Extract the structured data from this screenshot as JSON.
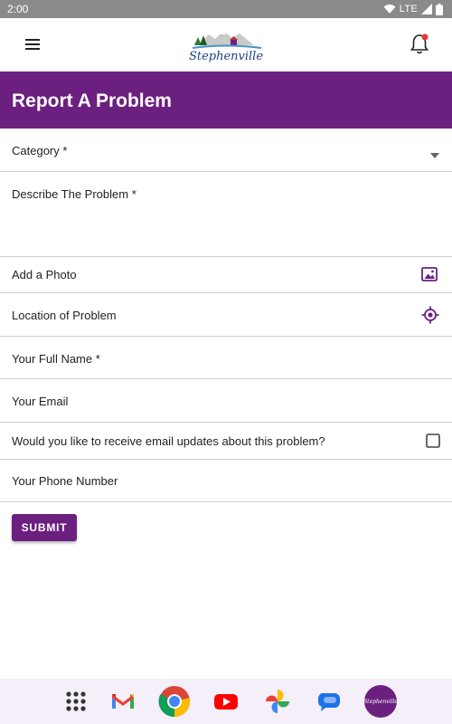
{
  "status_bar": {
    "time": "2:00",
    "network": "LTE"
  },
  "header": {
    "logo_text": "Stephenville"
  },
  "page": {
    "title": "Report A Problem"
  },
  "form": {
    "category_label": "Category *",
    "describe_label": "Describe The Problem *",
    "photo_label": "Add a Photo",
    "location_label": "Location of Problem",
    "name_label": "Your Full Name *",
    "email_label": "Your Email",
    "updates_label": "Would you like to receive email updates about this problem?",
    "updates_checked": false,
    "phone_label": "Your Phone Number",
    "submit_label": "SUBMIT"
  },
  "dock": {
    "stephenville_label": "Stephenville"
  },
  "colors": {
    "brand_purple": "#6b2080",
    "status_bar": "#8a8a8a",
    "dock_bg": "#f4eff8"
  },
  "icons": [
    "menu-icon",
    "bell-icon",
    "dropdown-arrow-icon",
    "image-icon",
    "location-target-icon",
    "checkbox-icon",
    "wifi-icon",
    "signal-icon",
    "battery-icon"
  ]
}
